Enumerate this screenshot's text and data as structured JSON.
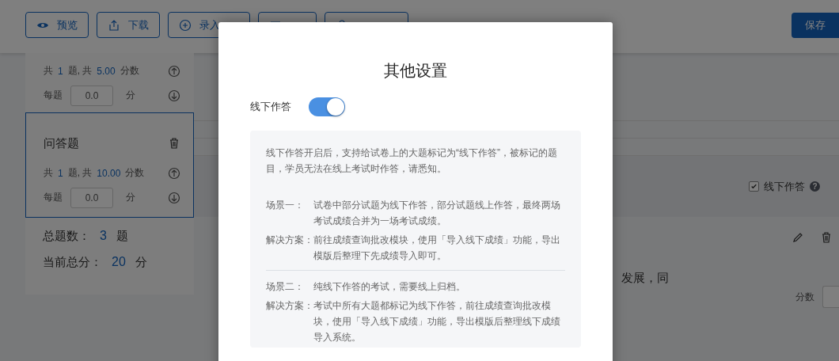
{
  "toolbar": {
    "buttons": [
      {
        "kind": "eye",
        "label": "预览"
      },
      {
        "kind": "upload",
        "label": "下载"
      },
      {
        "kind": "plus",
        "label": "录入"
      },
      {
        "kind": "list"
      },
      {
        "kind": "person"
      }
    ],
    "save": "保存"
  },
  "cards": [
    {
      "selected": false,
      "summary": [
        "共",
        "1",
        "题, 共",
        "5.00",
        "分数"
      ],
      "per_label": "每题",
      "per_value": "0.0",
      "per_unit": "分"
    },
    {
      "selected": true,
      "title": "问答题",
      "summary": [
        "共",
        "1",
        "题, 共",
        "10.00",
        "分数"
      ],
      "per_label": "每题",
      "per_value": "0.0",
      "per_unit": "分"
    }
  ],
  "totals": [
    {
      "label": "总题数：",
      "value": "3",
      "unit": "题"
    },
    {
      "label": "当前总分：",
      "value": "20",
      "unit": "分"
    }
  ],
  "right": {
    "checkbox": {
      "label": "线下作答",
      "checked": true,
      "help": "?"
    },
    "text": "发展，同",
    "score_label": "分数"
  },
  "dialog": {
    "title": "其他设置",
    "toggle": {
      "label": "线下作答",
      "on": true
    },
    "intro": "线下作答开启后，支持给试卷上的大题标记为“线下作答”，被标记的题目，学员无法在线上考试时作答，请悉知。",
    "scenarios": [
      {
        "items": [
          {
            "label": "场景一：",
            "text": "试卷中部分试题为线下作答，部分试题线上作答，最终两场考试成绩合并为一场考试成绩。"
          },
          {
            "label": "解决方案：",
            "text": "前往成绩查询批改模块，使用「导入线下成绩」功能，导出模版后整理下先成绩导入即可。"
          }
        ]
      },
      {
        "items": [
          {
            "label": "场景二：",
            "text": "纯线下作答的考试，需要线上归档。"
          },
          {
            "label": "解决方案：",
            "text": "考试中所有大题都标记为线下作答，前往成绩查询批改模块，使用「导入线下成绩」功能，导出模版后整理线下成绩导入系统。"
          }
        ]
      }
    ]
  }
}
